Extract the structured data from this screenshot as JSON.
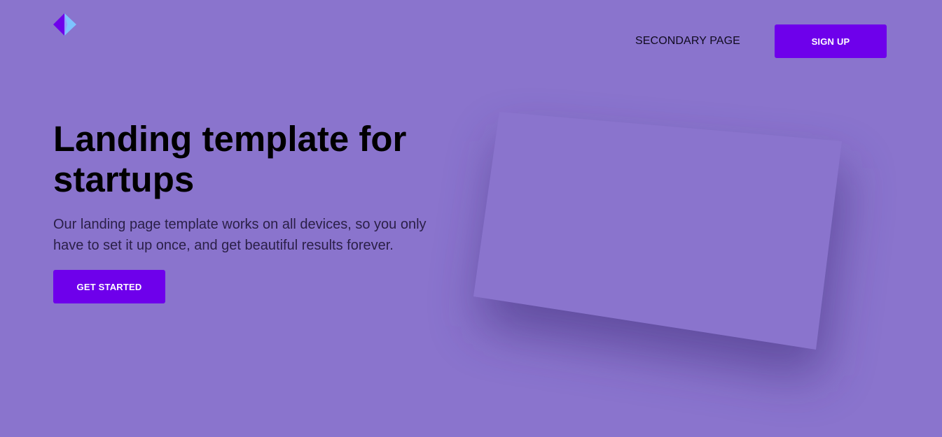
{
  "header": {
    "logo_icon": "diamond-logo-icon",
    "nav": {
      "secondary_link": "SECONDARY PAGE",
      "signup_label": "SIGN UP"
    }
  },
  "hero": {
    "title": "Landing template for startups",
    "subtitle": "Our landing page template works on all devices, so you only have to set it up once, and get beautiful results forever.",
    "cta_label": "GET STARTED"
  },
  "colors": {
    "background": "#8a74cd",
    "accent": "#6e00eb",
    "logo_left": "#6e00eb",
    "logo_right": "#7dc3ff"
  }
}
